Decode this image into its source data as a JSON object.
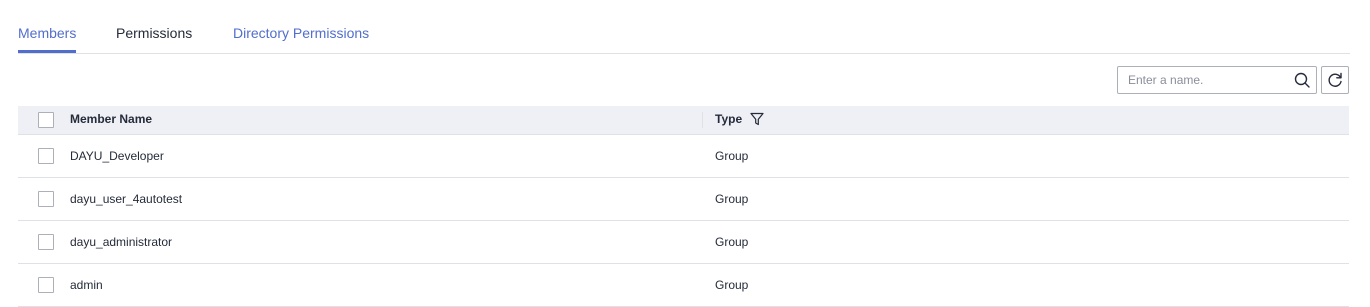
{
  "tabs": [
    {
      "label": "Members",
      "active": true
    },
    {
      "label": "Permissions",
      "active": false
    },
    {
      "label": "Directory Permissions",
      "active": false
    }
  ],
  "toolbar": {
    "search_placeholder": "Enter a name.",
    "search_value": "",
    "search_icon": "search-icon",
    "refresh_icon": "refresh-icon"
  },
  "table": {
    "columns": {
      "name": "Member Name",
      "type": "Type",
      "type_filter_icon": "filter-icon"
    },
    "rows": [
      {
        "name": "DAYU_Developer",
        "type": "Group"
      },
      {
        "name": "dayu_user_4autotest",
        "type": "Group"
      },
      {
        "name": "dayu_administrator",
        "type": "Group"
      },
      {
        "name": "admin",
        "type": "Group"
      }
    ]
  },
  "colors": {
    "accent": "#526ecc",
    "header_bg": "#eef0f5",
    "border": "#dfe1e6",
    "text": "#252b3a"
  }
}
